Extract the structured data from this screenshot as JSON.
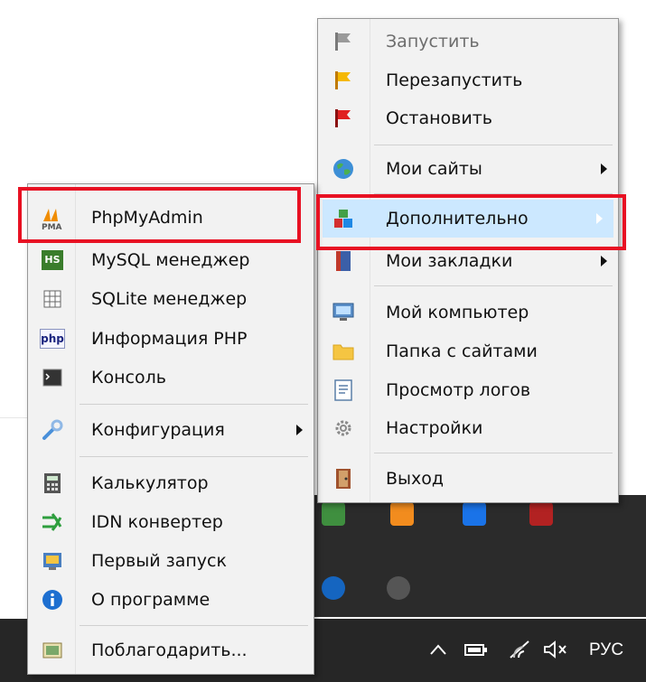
{
  "main_menu": {
    "items": [
      {
        "label": "Запустить",
        "icon": "flag-gray-icon",
        "disabled": true
      },
      {
        "label": "Перезапустить",
        "icon": "flag-yellow-icon"
      },
      {
        "label": "Остановить",
        "icon": "flag-red-icon"
      },
      {
        "label": "Мои сайты",
        "icon": "globe-icon",
        "submenu": true
      },
      {
        "label": "Дополнительно",
        "icon": "tools-icon",
        "submenu": true,
        "highlighted": true
      },
      {
        "label": "Мои закладки",
        "icon": "bookmarks-icon",
        "submenu": true
      },
      {
        "label": "Мой компьютер",
        "icon": "computer-icon"
      },
      {
        "label": "Папка с сайтами",
        "icon": "folder-icon"
      },
      {
        "label": "Просмотр логов",
        "icon": "log-icon"
      },
      {
        "label": "Настройки",
        "icon": "gear-icon"
      },
      {
        "label": "Выход",
        "icon": "exit-icon"
      }
    ]
  },
  "sub_menu": {
    "items": [
      {
        "label": "PhpMyAdmin",
        "icon": "pma-icon"
      },
      {
        "label": "MySQL менеджер",
        "icon": "heidisql-icon",
        "icon_text": "HS"
      },
      {
        "label": "SQLite менеджер",
        "icon": "sqlite-icon"
      },
      {
        "label": "Информация PHP",
        "icon": "php-icon",
        "icon_text": "php"
      },
      {
        "label": "Консоль",
        "icon": "console-icon"
      },
      {
        "label": "Конфигурация",
        "icon": "wrench-icon",
        "submenu": true
      },
      {
        "label": "Калькулятор",
        "icon": "calculator-icon"
      },
      {
        "label": "IDN конвертер",
        "icon": "idn-icon"
      },
      {
        "label": "Первый запуск",
        "icon": "wizard-icon"
      },
      {
        "label": "О программе",
        "icon": "info-icon"
      },
      {
        "label": "Поблагодарить...",
        "icon": "donate-icon"
      }
    ]
  },
  "taskbar": {
    "language": "РУС",
    "tray_icons": [
      "chevron-up-icon",
      "battery-icon",
      "wifi-icon",
      "volume-muted-icon"
    ]
  },
  "colors": {
    "highlight": "#cce8ff",
    "annotation": "#e81123",
    "menu_bg": "#f2f2f2"
  }
}
